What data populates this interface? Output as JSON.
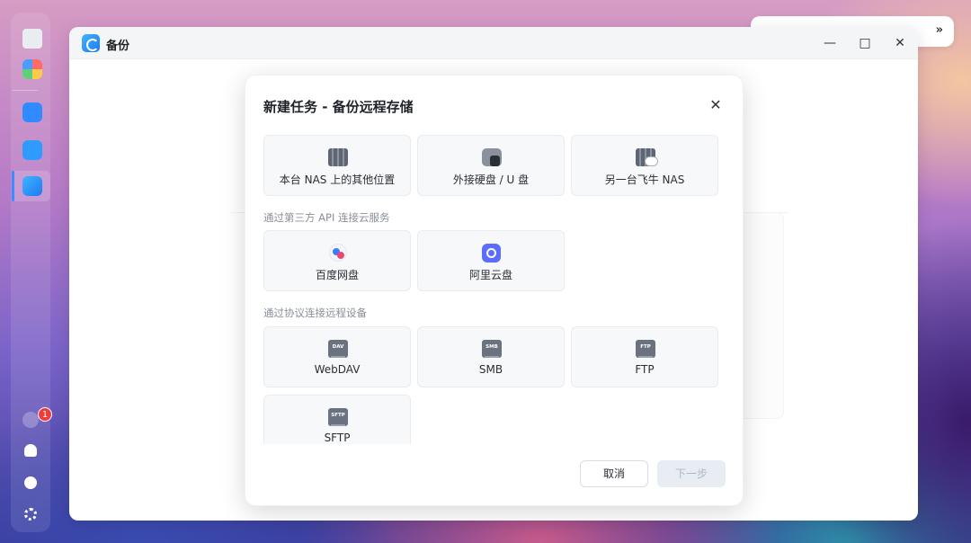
{
  "window": {
    "title": "备份",
    "controls": {
      "minimize": "—",
      "maximize": "□",
      "close": "✕"
    }
  },
  "dialog": {
    "title": "新建任务 - 备份远程存储",
    "close": "✕",
    "sections": [
      {
        "label": "",
        "options": [
          {
            "label": "本台 NAS 上的其他位置",
            "icon": "nas-server-icon"
          },
          {
            "label": "外接硬盘 / U 盘",
            "icon": "external-drive-icon"
          },
          {
            "label": "另一台飞牛 NAS",
            "icon": "remote-nas-icon"
          }
        ]
      },
      {
        "label": "通过第三方 API 连接云服务",
        "options": [
          {
            "label": "百度网盘",
            "icon": "baidu-netdisk-icon"
          },
          {
            "label": "阿里云盘",
            "icon": "aliyun-drive-icon"
          }
        ]
      },
      {
        "label": "通过协议连接远程设备",
        "options": [
          {
            "label": "WebDAV",
            "icon": "webdav-icon",
            "tag": "DAV"
          },
          {
            "label": "SMB",
            "icon": "smb-icon",
            "tag": "SMB"
          },
          {
            "label": "FTP",
            "icon": "ftp-icon",
            "tag": "FTP"
          },
          {
            "label": "SFTP",
            "icon": "sftp-icon",
            "tag": "SFTP"
          }
        ]
      }
    ],
    "buttons": {
      "cancel": "取消",
      "next": "下一步"
    }
  },
  "dock": {
    "notification_count": "1"
  },
  "status_bar": {
    "collapse": "»"
  },
  "colors": {
    "accent": "#3b8cff",
    "badge": "#ef3b3b",
    "disabled_button": "#e8ecf3"
  }
}
